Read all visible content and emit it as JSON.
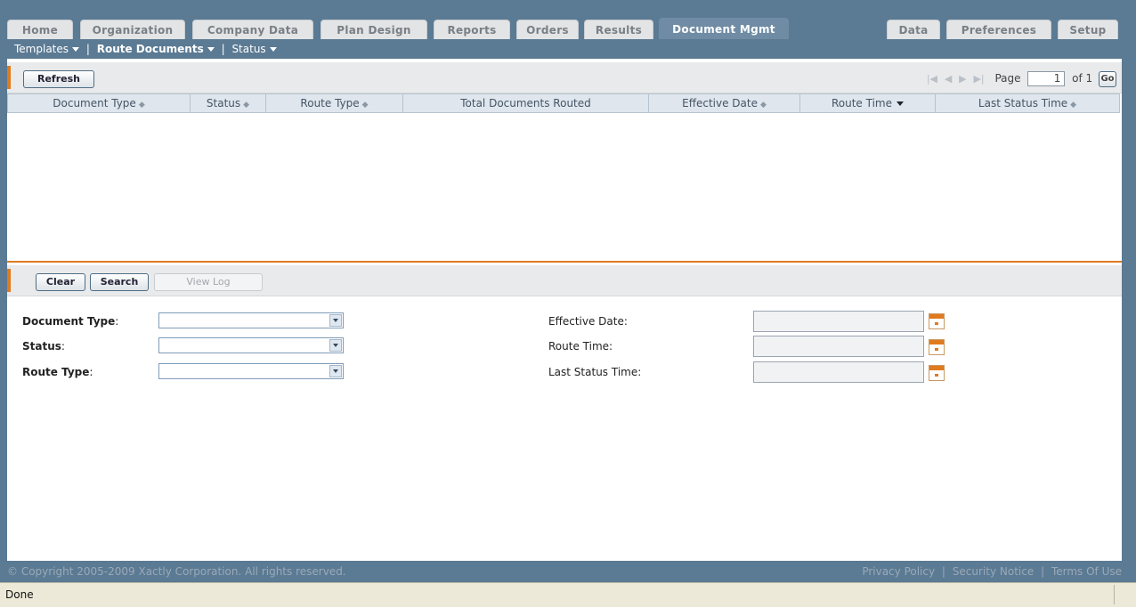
{
  "tabs": [
    {
      "label": "Home",
      "active": false
    },
    {
      "label": "Organization",
      "active": false
    },
    {
      "label": "Company Data",
      "active": false
    },
    {
      "label": "Plan Design",
      "active": false
    },
    {
      "label": "Reports",
      "active": false
    },
    {
      "label": "Orders",
      "active": false
    },
    {
      "label": "Results",
      "active": false
    },
    {
      "label": "Document Mgmt",
      "active": true
    },
    {
      "label": "Data",
      "active": false
    },
    {
      "label": "Preferences",
      "active": false
    },
    {
      "label": "Setup",
      "active": false
    }
  ],
  "subnav": {
    "templates": "Templates",
    "route_documents": "Route Documents",
    "status": "Status",
    "separator": "|"
  },
  "grid_toolbar": {
    "refresh": "Refresh",
    "page_label": "Page",
    "page_value": "1",
    "of_label": "of 1",
    "go": "Go"
  },
  "grid_columns": [
    {
      "label": "Document Type",
      "sort": "both"
    },
    {
      "label": "Status",
      "sort": "both"
    },
    {
      "label": "Route Type",
      "sort": "both"
    },
    {
      "label": "Total Documents Routed",
      "sort": "none"
    },
    {
      "label": "Effective Date",
      "sort": "both"
    },
    {
      "label": "Route Time",
      "sort": "desc"
    },
    {
      "label": "Last Status Time",
      "sort": "both"
    }
  ],
  "search_toolbar": {
    "clear": "Clear",
    "search": "Search",
    "view_log": "View Log"
  },
  "form": {
    "document_type_label": "Document Type",
    "status_label": "Status",
    "route_type_label": "Route Type",
    "colon": ":",
    "effective_date_label": "Effective Date:",
    "route_time_label": "Route Time:",
    "last_status_time_label": "Last Status Time:"
  },
  "footer": {
    "copyright": "© Copyright 2005-2009 Xactly Corporation. All rights reserved.",
    "privacy": "Privacy Policy",
    "security": "Security Notice",
    "terms": "Terms Of Use",
    "separator": "|"
  },
  "statusbar": {
    "text": "Done"
  },
  "colors": {
    "frame": "#5b7a93",
    "active_tab": "#6f8ca4",
    "accent": "#e07a1f"
  }
}
